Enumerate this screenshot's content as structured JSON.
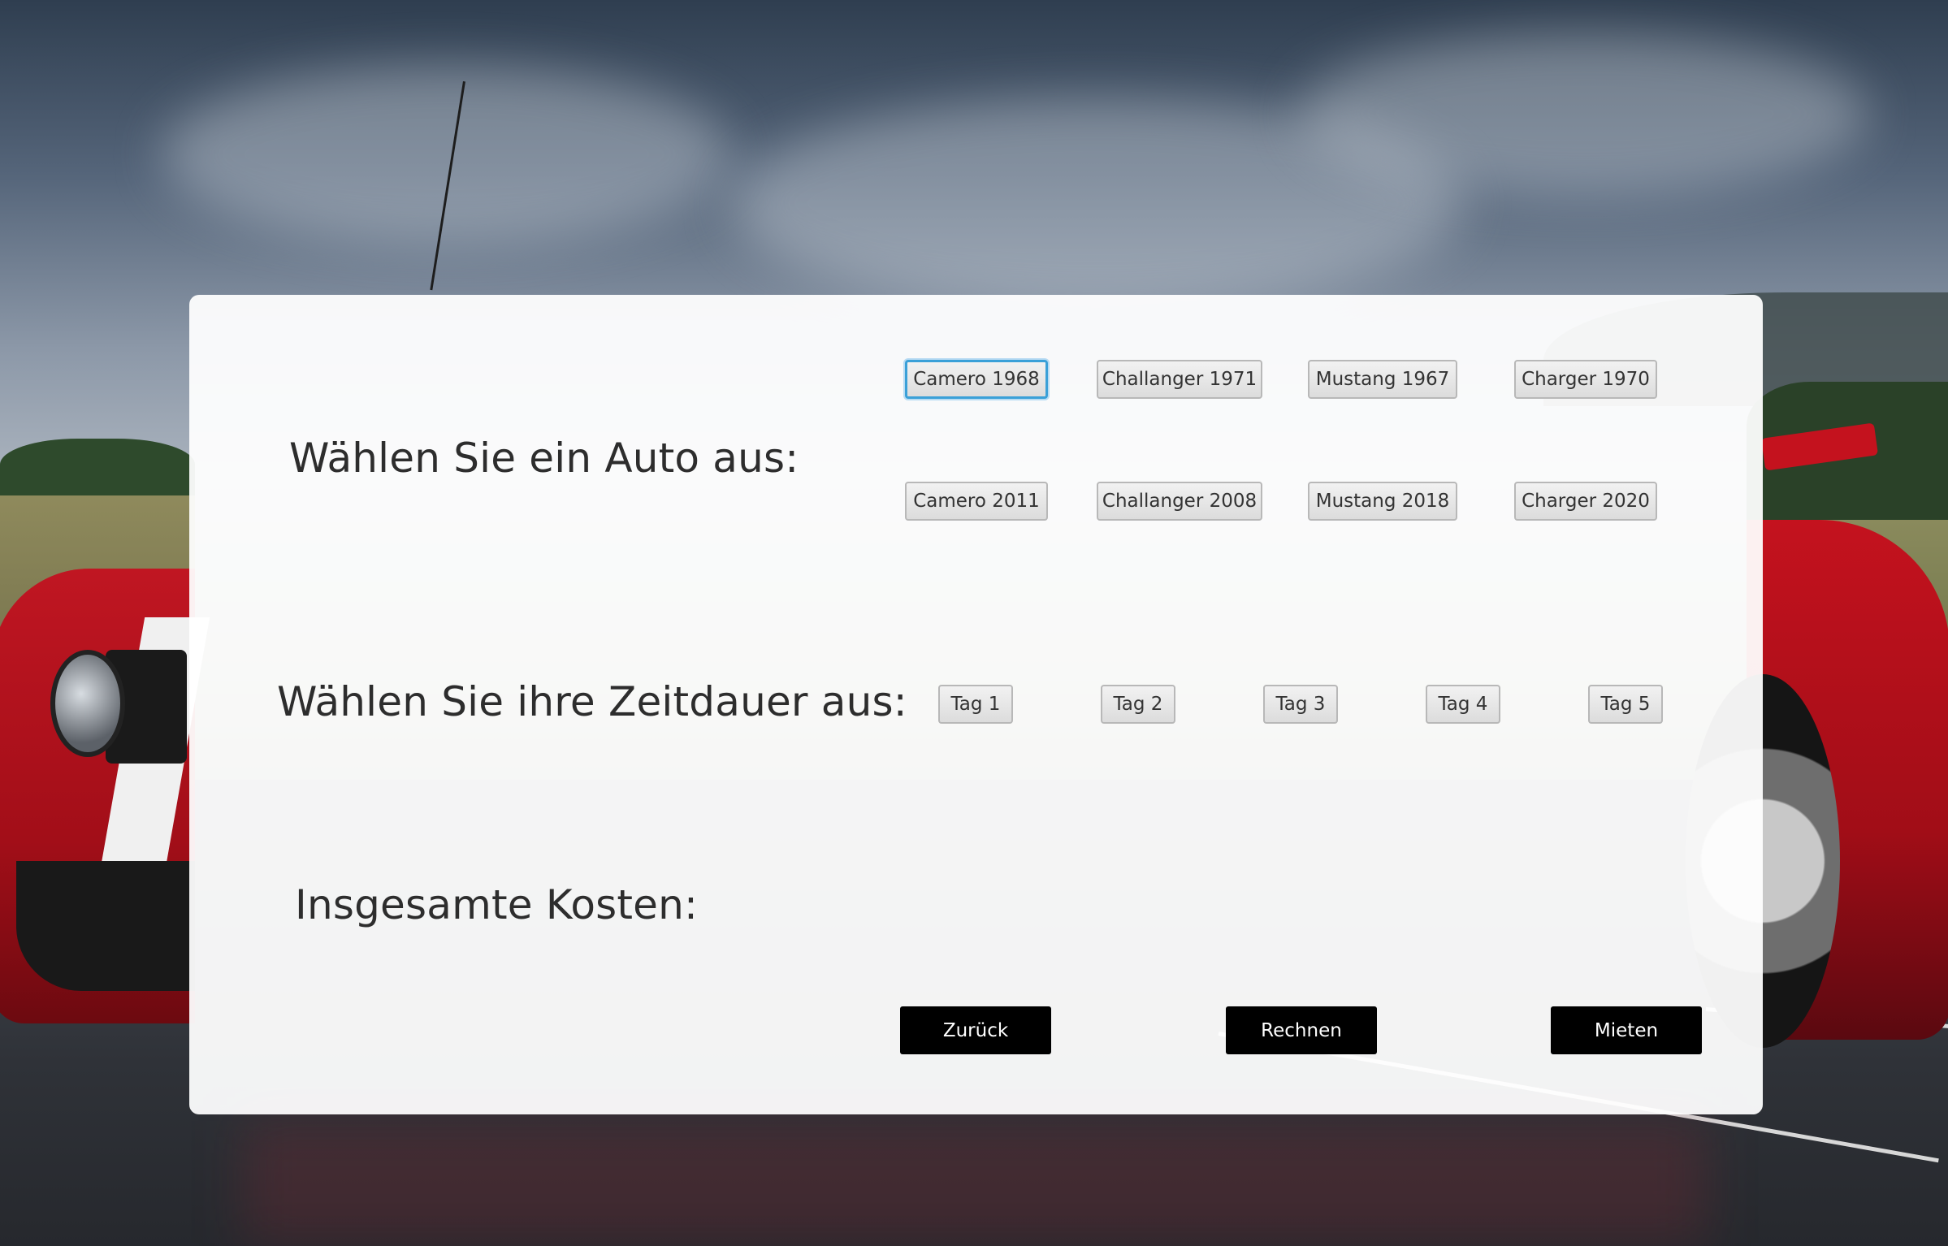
{
  "headings": {
    "car": "Wählen Sie ein Auto aus:",
    "duration": "Wählen Sie ihre Zeitdauer aus:",
    "total": "Insgesamte Kosten:"
  },
  "cars": [
    {
      "label": "Camero 1968",
      "selected": true
    },
    {
      "label": "Challanger 1971",
      "selected": false
    },
    {
      "label": "Mustang 1967",
      "selected": false
    },
    {
      "label": "Charger 1970",
      "selected": false
    },
    {
      "label": "Camero 2011",
      "selected": false
    },
    {
      "label": "Challanger 2008",
      "selected": false
    },
    {
      "label": "Mustang 2018",
      "selected": false
    },
    {
      "label": "Charger 2020",
      "selected": false
    }
  ],
  "days": [
    "Tag 1",
    "Tag 2",
    "Tag 3",
    "Tag 4",
    "Tag 5"
  ],
  "total_cost": "",
  "actions": {
    "back": "Zurück",
    "calculate": "Rechnen",
    "rent": "Mieten"
  },
  "colors": {
    "selected_border": "#3aa0d8",
    "action_button": "#000000",
    "panel": "#ffffff"
  }
}
